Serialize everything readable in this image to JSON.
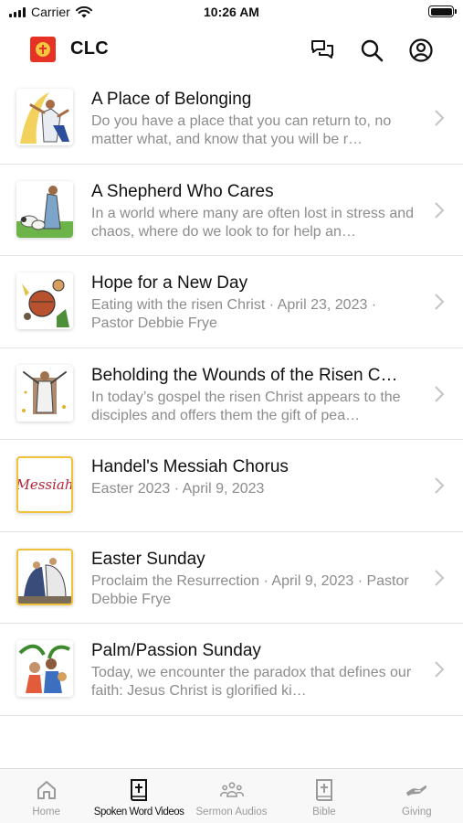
{
  "status": {
    "carrier": "Carrier",
    "time": "10:26 AM"
  },
  "header": {
    "title": "CLC",
    "icons": [
      "chat-icon",
      "search-icon",
      "account-icon"
    ]
  },
  "items": [
    {
      "title": "A Place of Belonging",
      "description": "Do you have a place that you can return to, no matter what, and know that you will be r…",
      "framed": false
    },
    {
      "title": "A Shepherd Who Cares",
      "description": "In a world where many are often lost in stress and chaos, where do we look to for help an…",
      "framed": false
    },
    {
      "title": "Hope for a New Day",
      "description": "Eating with the risen Christ · April 23, 2023 · Pastor Debbie Frye",
      "framed": false
    },
    {
      "title": "Beholding the Wounds of the Risen C…",
      "description": "In today’s gospel the risen Christ appears to the disciples and offers them the gift of pea…",
      "framed": false
    },
    {
      "title": "Handel's Messiah Chorus",
      "description": "Easter 2023 · April 9, 2023",
      "framed": true,
      "thumb_text": "Messiah"
    },
    {
      "title": "Easter Sunday",
      "description": "Proclaim the Resurrection · April 9, 2023 · Pastor Debbie Frye",
      "framed": true
    },
    {
      "title": "Palm/Passion Sunday",
      "description": "Today, we encounter the paradox that defines our faith: Jesus Christ is glorified ki…",
      "framed": false
    }
  ],
  "tabs": [
    {
      "label": "Home",
      "icon": "home-icon",
      "active": false
    },
    {
      "label": "Spoken Word Videos",
      "icon": "bible-icon",
      "active": true
    },
    {
      "label": "Sermon Audios",
      "icon": "group-icon",
      "active": false
    },
    {
      "label": "Bible",
      "icon": "bible-icon",
      "active": false
    },
    {
      "label": "Giving",
      "icon": "giving-hand-icon",
      "active": false
    }
  ],
  "colors": {
    "accent": "#f0c23b",
    "brand": "#e53224",
    "secondary_text": "#8c8c8c"
  }
}
